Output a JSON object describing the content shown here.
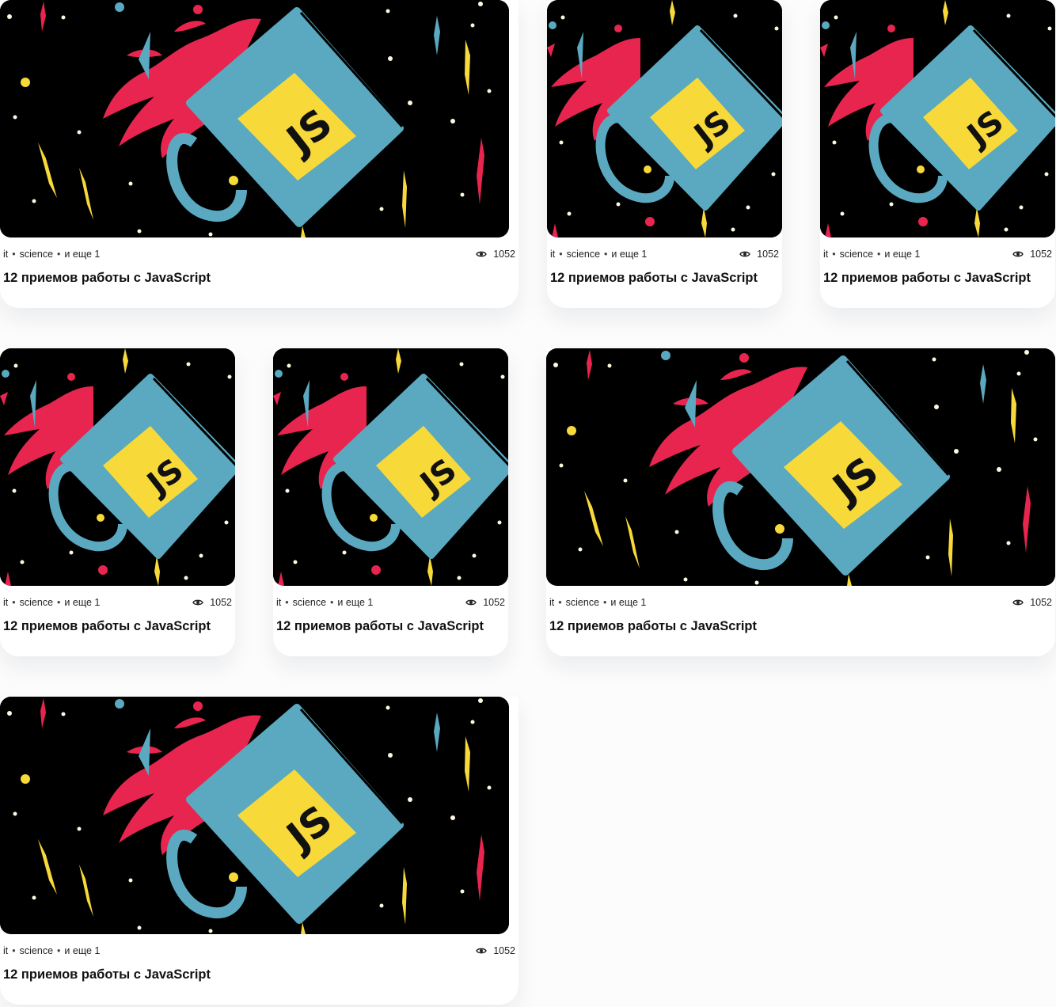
{
  "cards": [
    {
      "tags": [
        "it",
        "science",
        "и еще 1"
      ],
      "views": "1052",
      "title": "12 приемов работы с JavaScript",
      "image": "js-mug-illustration"
    },
    {
      "tags": [
        "it",
        "science",
        "и еще 1"
      ],
      "views": "1052",
      "title": "12 приемов работы с JavaScript",
      "image": "js-mug-illustration"
    },
    {
      "tags": [
        "it",
        "science",
        "и еще 1"
      ],
      "views": "1052",
      "title": "12 приемов работы с JavaScript",
      "image": "js-mug-illustration"
    },
    {
      "tags": [
        "it",
        "science",
        "и еще 1"
      ],
      "views": "1052",
      "title": "12 приемов работы с JavaScript",
      "image": "js-mug-illustration"
    },
    {
      "tags": [
        "it",
        "science",
        "и еще 1"
      ],
      "views": "1052",
      "title": "12 приемов работы с JavaScript",
      "image": "js-mug-illustration"
    },
    {
      "tags": [
        "it",
        "science",
        "и еще 1"
      ],
      "views": "1052",
      "title": "12 приемов работы с JavaScript",
      "image": "js-mug-illustration"
    },
    {
      "tags": [
        "it",
        "science",
        "и еще 1"
      ],
      "views": "1052",
      "title": "12 приемов работы с JavaScript",
      "image": "js-mug-illustration"
    }
  ],
  "icons": {
    "views": "eye-icon"
  },
  "colors": {
    "background": "#fcfcfc",
    "image_bg": "#000000",
    "mug": "#5aa9c0",
    "label": "#f7d93a",
    "splash": "#e8254f",
    "text": "#111111"
  }
}
